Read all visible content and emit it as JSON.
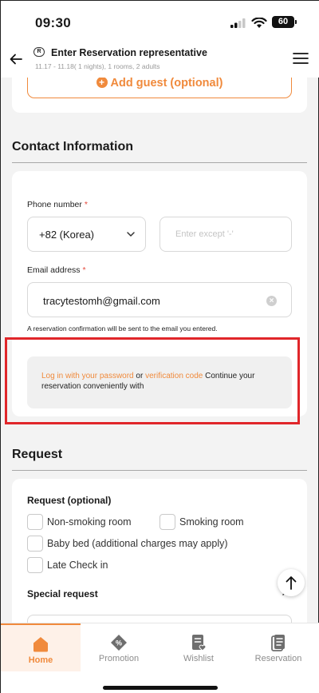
{
  "status_bar": {
    "time": "09:30",
    "battery": "60"
  },
  "header": {
    "badge": "R",
    "title": "Enter Reservation representative",
    "subtitle": "11.17 - 11.18( 1 nights), 1 rooms, 2 adults"
  },
  "guest": {
    "add_label": "Add guest (optional)"
  },
  "contact": {
    "title": "Contact Information",
    "phone_label": "Phone number",
    "required_mark": "*",
    "country": "+82 (Korea)",
    "phone_placeholder": "Enter except '-'",
    "email_label": "Email address",
    "email_value": "tracytestomh@gmail.com",
    "email_hint": "A reservation confirmation will be sent to the email you entered.",
    "login_link": "Log in with your password",
    "login_or": "or",
    "verify_link": "verification code",
    "login_rest": "Continue your reservation conveniently with"
  },
  "request": {
    "title": "Request",
    "subtitle": "Request (optional)",
    "options": [
      "Non-smoking room",
      "Smoking room",
      "Baby bed (additional charges may apply)",
      "Late Check in"
    ],
    "special_label": "Special request"
  },
  "bottom_nav": {
    "items": [
      {
        "label": "Home",
        "icon": "home-icon",
        "active": true
      },
      {
        "label": "Promotion",
        "icon": "promotion-icon",
        "active": false
      },
      {
        "label": "Wishlist",
        "icon": "wishlist-icon",
        "active": false
      },
      {
        "label": "Reservation",
        "icon": "reservation-icon",
        "active": false
      }
    ]
  },
  "colors": {
    "accent": "#f08a3c",
    "highlight": "#e0262a",
    "required": "#e5483b"
  }
}
